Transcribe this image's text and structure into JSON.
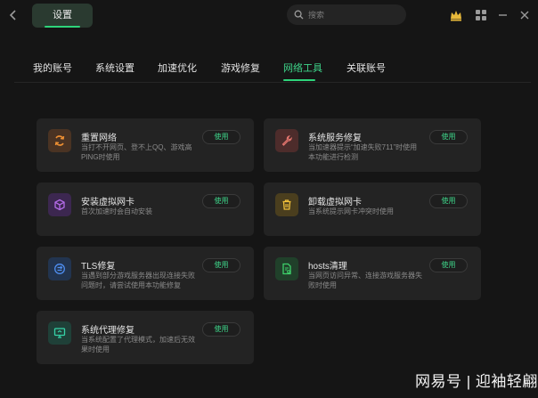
{
  "titlebar": {
    "window_tab": "设置",
    "search_placeholder": "搜索"
  },
  "nav": {
    "tabs": [
      {
        "label": "我的账号",
        "active": false
      },
      {
        "label": "系统设置",
        "active": false
      },
      {
        "label": "加速优化",
        "active": false
      },
      {
        "label": "游戏修复",
        "active": false
      },
      {
        "label": "网络工具",
        "active": true
      },
      {
        "label": "关联账号",
        "active": false
      }
    ]
  },
  "cards": [
    {
      "title": "重置网络",
      "desc": "当打不开网页、登不上QQ、游戏高PING时使用",
      "button": "使用",
      "icon": "refresh-icon",
      "color": "#f09133"
    },
    {
      "title": "系统服务修复",
      "desc": "当加速器提示“加速失败711”时使用本功能进行检测",
      "button": "使用",
      "icon": "wrench-icon",
      "color": "#e6766f"
    },
    {
      "title": "安装虚拟网卡",
      "desc": "首次加速时会自动安装",
      "button": "使用",
      "icon": "cube-icon",
      "color": "#b46be8"
    },
    {
      "title": "卸载虚拟网卡",
      "desc": "当系统提示网卡冲突时使用",
      "button": "使用",
      "icon": "trash-icon",
      "color": "#f2c23b"
    },
    {
      "title": "TLS修复",
      "desc": "当遇到部分游戏服务器出现连接失败问题时，请尝试使用本功能修复",
      "button": "使用",
      "icon": "tls-icon",
      "color": "#4f8ef0"
    },
    {
      "title": "hosts清理",
      "desc": "当网页访问异常、连接游戏服务器失败时使用",
      "button": "使用",
      "icon": "file-clean-icon",
      "color": "#3ecf6a"
    },
    {
      "title": "系统代理修复",
      "desc": "当系统配置了代理模式，加速后无效果时使用",
      "button": "使用",
      "icon": "monitor-icon",
      "color": "#36d3a8"
    }
  ],
  "watermark": "网易号 | 迎袖轻翩"
}
